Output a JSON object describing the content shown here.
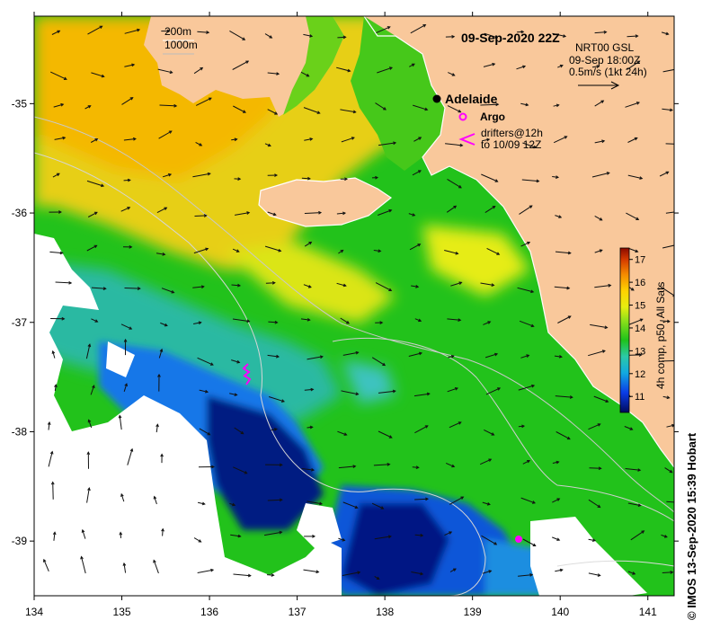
{
  "map": {
    "title": "09-Sep-2020 22Z",
    "product": "NRT00 GSL",
    "currents_time": "09-Sep 18:00Z",
    "current_scale": "0.5m/s (1kt 24h)",
    "depth_contours": [
      "200m",
      "1000m"
    ],
    "places": [
      {
        "name": "Adelaide",
        "lon": 138.6,
        "lat": -34.93
      }
    ],
    "argo_label": "Argo",
    "drifter_label_1": "drifters@12h",
    "drifter_label_2": "to 10/09 12Z",
    "colorbar_label": "4h comp, p50, All Sats",
    "colorbar_ticks": [
      "11",
      "12",
      "13",
      "14",
      "15",
      "16",
      "17"
    ],
    "lon_ticks": [
      "134",
      "135",
      "136",
      "137",
      "138",
      "139",
      "140",
      "141"
    ],
    "lat_ticks": [
      "-35",
      "-36",
      "-37",
      "-38",
      "-39"
    ],
    "credit": "© IMOS 13-Sep-2020 15:39 Hobart",
    "colors": {
      "land": "#f9c89b",
      "warm": "#f2b400",
      "mid": "#cfe60c",
      "green": "#22c21b",
      "teal": "#22b0b3",
      "blue": "#0a58e0",
      "navy": "#001a82",
      "argo": "#ff00ff"
    },
    "argo_floats": [
      {
        "lon": 139.55,
        "lat": -38.96
      }
    ],
    "drifters": [
      {
        "lon": 136.45,
        "lat": -37.4
      }
    ]
  }
}
